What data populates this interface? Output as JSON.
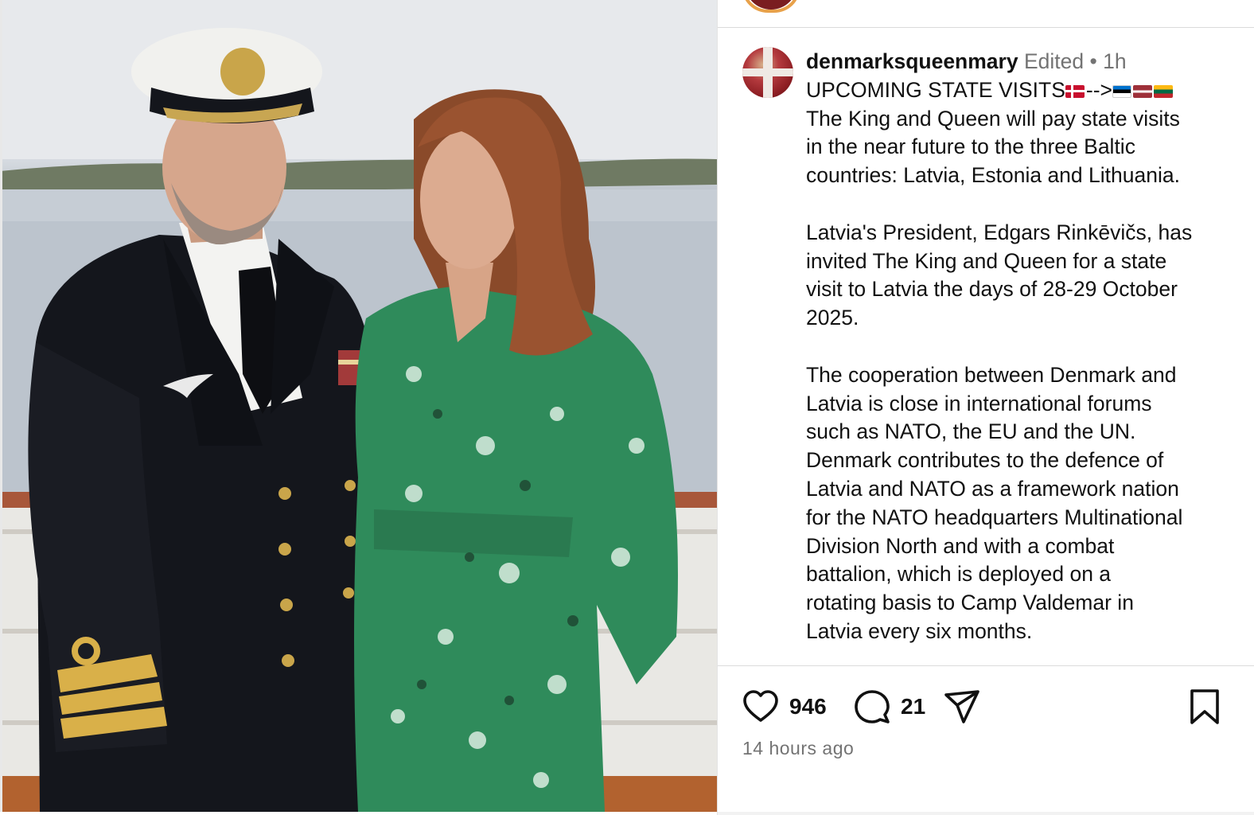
{
  "post": {
    "username": "denmarksqueenmary",
    "edited_label": "Edited",
    "separator": "•",
    "time_short": "1h",
    "headline": "UPCOMING STATE VISITS",
    "headline_arrow": "-->",
    "paragraphs": [
      [
        "The King and Queen will pay state visits",
        "in the near future to the three Baltic",
        "countries: Latvia, Estonia and Lithuania."
      ],
      [
        "Latvia's President, Edgars Rinkēvičs, has",
        "invited The King and Queen for a state",
        "visit to Latvia the days of 28-29 October",
        "2025."
      ],
      [
        "The cooperation between Denmark and",
        "Latvia is close in international forums",
        "such as NATO, the EU and the UN.",
        "Denmark contributes to the defence of",
        "Latvia and NATO as a framework nation",
        "for the NATO headquarters Multinational",
        "Division North and with a combat",
        "battalion, which is deployed on a",
        "rotating basis to Camp Valdemar in",
        "Latvia every six months."
      ]
    ],
    "likes": "946",
    "comments": "21",
    "time_ago": "14 hours ago"
  },
  "icons": {
    "like": "heart-icon",
    "comment": "comment-icon",
    "share": "share-icon",
    "save": "bookmark-icon"
  },
  "colors": {
    "text": "#111111",
    "muted": "#737373",
    "divider": "#dbdbdb",
    "story_ring": "#e8a14a"
  }
}
